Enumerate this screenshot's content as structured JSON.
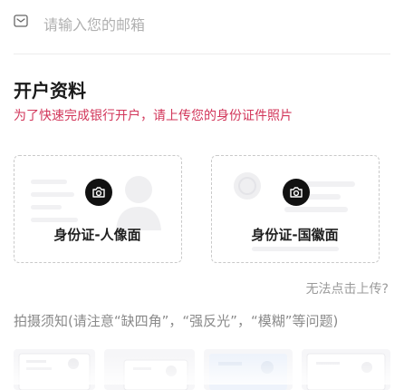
{
  "email": {
    "placeholder": "请输入您的邮箱",
    "value": ""
  },
  "account_info": {
    "title": "开户资料",
    "subtitle": "为了快速完成银行开户，请上传您的身份证件照片",
    "subtitle_color": "#d2365a"
  },
  "id_cards": [
    {
      "label": "身份证-人像面",
      "icon": "camera-icon"
    },
    {
      "label": "身份证-国徽面",
      "icon": "camera-icon"
    }
  ],
  "upload_help": "无法点击上传?",
  "photo_notes": {
    "title": "拍摄须知(请注意“缺四角”，“强反光”，“模糊”等问题)"
  }
}
